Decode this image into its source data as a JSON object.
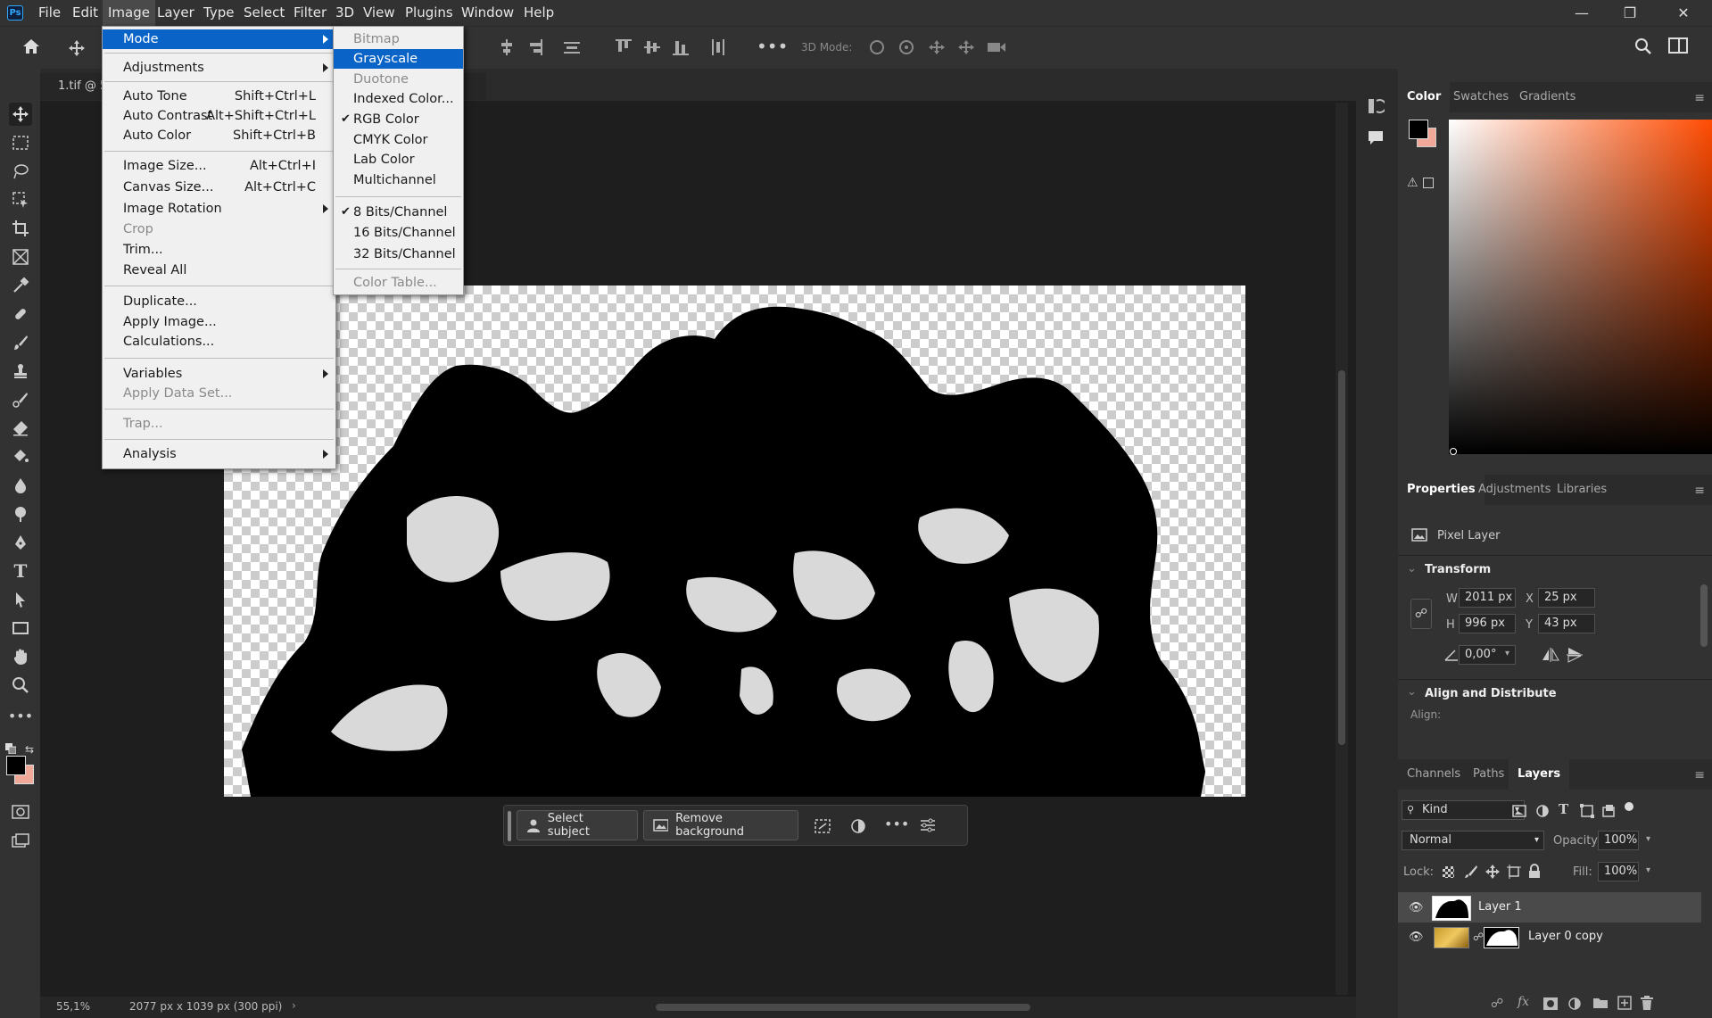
{
  "app": {
    "logo": "Ps"
  },
  "menubar": {
    "items": [
      "File",
      "Edit",
      "Image",
      "Layer",
      "Type",
      "Select",
      "Filter",
      "3D",
      "View",
      "Plugins",
      "Window",
      "Help"
    ],
    "active": "Image"
  },
  "window_controls": {
    "minimize": "minimize-icon",
    "restore": "restore-icon",
    "close": "close-icon"
  },
  "options_bar": {
    "mode_label": "3D Mode:"
  },
  "document": {
    "tab_title": "1.tif @ 5"
  },
  "image_menu": {
    "items": [
      {
        "label": "Mode",
        "shortcut": "",
        "submenu": true,
        "disabled": false,
        "highlight": true
      },
      {
        "label": "Adjustments",
        "shortcut": "",
        "submenu": true,
        "disabled": false
      },
      {
        "label": "Auto Tone",
        "shortcut": "Shift+Ctrl+L"
      },
      {
        "label": "Auto Contrast",
        "shortcut": "Alt+Shift+Ctrl+L"
      },
      {
        "label": "Auto Color",
        "shortcut": "Shift+Ctrl+B"
      },
      {
        "label": "Image Size...",
        "shortcut": "Alt+Ctrl+I"
      },
      {
        "label": "Canvas Size...",
        "shortcut": "Alt+Ctrl+C"
      },
      {
        "label": "Image Rotation",
        "shortcut": "",
        "submenu": true
      },
      {
        "label": "Crop",
        "shortcut": "",
        "disabled": true
      },
      {
        "label": "Trim...",
        "shortcut": ""
      },
      {
        "label": "Reveal All",
        "shortcut": ""
      },
      {
        "label": "Duplicate...",
        "shortcut": ""
      },
      {
        "label": "Apply Image...",
        "shortcut": ""
      },
      {
        "label": "Calculations...",
        "shortcut": ""
      },
      {
        "label": "Variables",
        "shortcut": "",
        "submenu": true
      },
      {
        "label": "Apply Data Set...",
        "shortcut": "",
        "disabled": true
      },
      {
        "label": "Trap...",
        "shortcut": "",
        "disabled": true
      },
      {
        "label": "Analysis",
        "shortcut": "",
        "submenu": true
      }
    ]
  },
  "mode_submenu": {
    "items": [
      {
        "label": "Bitmap",
        "disabled": true
      },
      {
        "label": "Grayscale",
        "highlight": true
      },
      {
        "label": "Duotone",
        "disabled": true
      },
      {
        "label": "Indexed Color..."
      },
      {
        "label": "RGB Color",
        "checked": true
      },
      {
        "label": "CMYK Color"
      },
      {
        "label": "Lab Color"
      },
      {
        "label": "Multichannel"
      },
      {
        "label": "8 Bits/Channel",
        "checked": true
      },
      {
        "label": "16 Bits/Channel"
      },
      {
        "label": "32 Bits/Channel"
      },
      {
        "label": "Color Table...",
        "disabled": true
      }
    ]
  },
  "taskbar": {
    "select_subject": "Select subject",
    "remove_background": "Remove background"
  },
  "status": {
    "zoom": "55,1%",
    "doc_info": "2077 px x 1039 px (300 ppi)"
  },
  "color_panel": {
    "tabs": [
      "Color",
      "Swatches",
      "Gradients"
    ],
    "active": "Color",
    "fg": "#000000",
    "bg": "#f0a898"
  },
  "properties_panel": {
    "tabs": [
      "Properties",
      "Adjustments",
      "Libraries"
    ],
    "active": "Properties",
    "layer_type": "Pixel Layer",
    "transform_title": "Transform",
    "w_label": "W",
    "w": "2011 px",
    "x_label": "X",
    "x": "25 px",
    "h_label": "H",
    "h": "996 px",
    "y_label": "Y",
    "y": "43 px",
    "angle": "0,00°",
    "align_title": "Align and Distribute",
    "align_label": "Align:"
  },
  "layers_panel": {
    "tabs": [
      "Channels",
      "Paths",
      "Layers"
    ],
    "active": "Layers",
    "filter": "Kind",
    "blend": "Normal",
    "opacity_label": "Opacity:",
    "opacity": "100%",
    "lock_label": "Lock:",
    "fill_label": "Fill:",
    "fill": "100%",
    "layers": [
      {
        "name": "Layer 1",
        "selected": true
      },
      {
        "name": "Layer 0 copy",
        "selected": false
      }
    ]
  }
}
